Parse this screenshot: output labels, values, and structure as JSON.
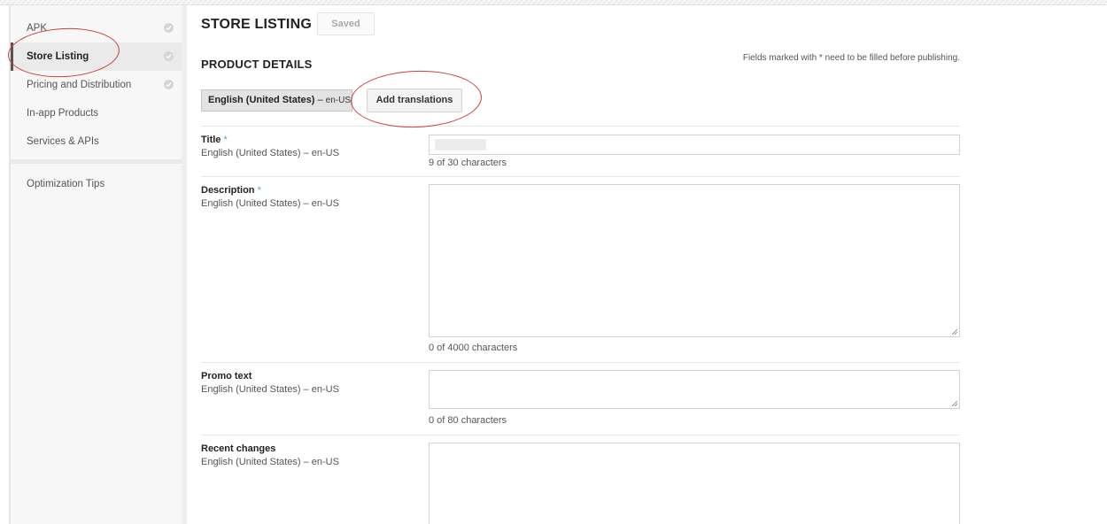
{
  "sidebar": {
    "items": [
      {
        "label": "APK",
        "checked": true,
        "active": false
      },
      {
        "label": "Store Listing",
        "checked": true,
        "active": true
      },
      {
        "label": "Pricing and Distribution",
        "checked": true,
        "active": false
      },
      {
        "label": "In-app Products",
        "checked": false,
        "active": false
      },
      {
        "label": "Services & APIs",
        "checked": false,
        "active": false
      }
    ],
    "tips_label": "Optimization Tips"
  },
  "header": {
    "title": "STORE LISTING",
    "saved_label": "Saved"
  },
  "product_details": {
    "title": "PRODUCT DETAILS",
    "required_note": "Fields marked with * need to be filled before publishing.",
    "language_tab": {
      "name": "English (United States)",
      "separator": " – ",
      "code": "en-US"
    },
    "add_translations_label": "Add translations"
  },
  "fields": {
    "title": {
      "label": "Title",
      "required": "*",
      "language": "English (United States) – en-US",
      "count": "9 of 30 characters"
    },
    "description": {
      "label": "Description",
      "required": "*",
      "language": "English (United States) – en-US",
      "count": "0 of 4000 characters"
    },
    "promo": {
      "label": "Promo text",
      "language": "English (United States) – en-US",
      "count": "0 of 80 characters"
    },
    "recent_changes": {
      "label": "Recent changes",
      "language": "English (United States) – en-US"
    }
  },
  "colors": {
    "annotation": "#c9403f",
    "required_asterisk": "#5aa1c4"
  }
}
